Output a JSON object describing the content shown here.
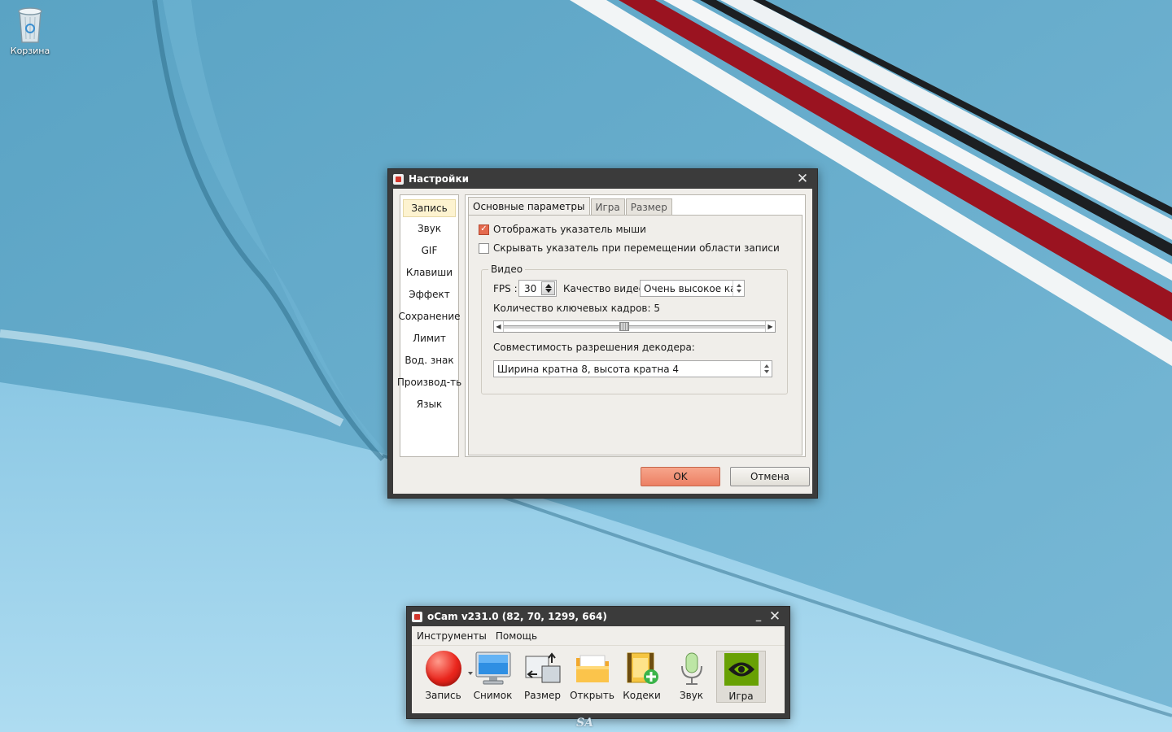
{
  "desktop": {
    "recycle_bin_label": "Корзина",
    "watermark": "SA"
  },
  "settings_dialog": {
    "title": "Настройки",
    "categories": [
      "Запись",
      "Звук",
      "GIF",
      "Клавиши",
      "Эффект",
      "Сохранение",
      "Лимит",
      "Вод. знак",
      "Производ-ть",
      "Язык"
    ],
    "selected_category": "Запись",
    "tabs": [
      "Основные параметры",
      "Игра",
      "Размер"
    ],
    "selected_tab": "Основные параметры",
    "show_cursor": {
      "label": "Отображать указатель мыши",
      "checked": true
    },
    "hide_cursor": {
      "label": "Скрывать указатель при перемещении области записи",
      "checked": false
    },
    "video_group": {
      "title": "Видео",
      "fps_label": "FPS :",
      "fps_value": "30",
      "quality_label": "Качество видео:",
      "quality_value": "Очень высокое кач",
      "keyframes_label": "Количество ключевых кадров: 5",
      "keyframes_slider_fraction": 0.46,
      "decoder_label": "Совместимость разрешения декодера:",
      "decoder_value": "Ширина кратна 8, высота кратна 4"
    },
    "ok_label": "OK",
    "cancel_label": "Отмена"
  },
  "ocam": {
    "title": "oCam v231.0 (82, 70, 1299, 664)",
    "menu": [
      "Инструменты",
      "Помощь"
    ],
    "tools": [
      {
        "label": "Запись",
        "icon": "record-icon"
      },
      {
        "label": "Снимок",
        "icon": "monitor-icon"
      },
      {
        "label": "Размер",
        "icon": "resize-icon"
      },
      {
        "label": "Открыть",
        "icon": "folder-icon"
      },
      {
        "label": "Кодеки",
        "icon": "codecs-icon"
      },
      {
        "label": "Звук",
        "icon": "microphone-icon"
      },
      {
        "label": "Игра",
        "icon": "nvidia-game-icon"
      }
    ]
  },
  "colors": {
    "window_frame": "#3b3b3b",
    "client_bg": "#f0eeea",
    "accent_orange": "#ec8064",
    "wallpaper_blue": "#62aac9"
  }
}
